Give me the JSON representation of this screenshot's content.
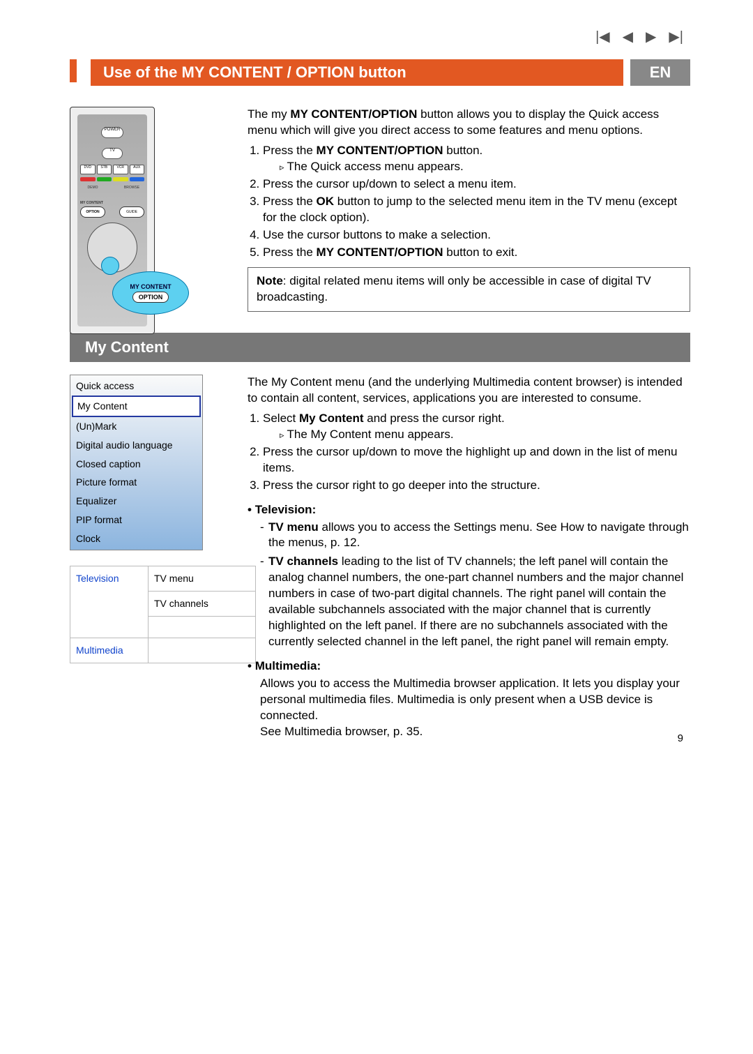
{
  "nav_icons": [
    "first-icon",
    "prev-icon",
    "next-icon",
    "last-icon"
  ],
  "header": {
    "title": "Use of the MY CONTENT / OPTION button",
    "lang": "EN"
  },
  "section1": {
    "intro_pre": "The my ",
    "intro_bold": "MY CONTENT/OPTION",
    "intro_post": " button allows you to display the Quick access menu which will give you direct access to some features and menu options.",
    "step1_pre": "Press the ",
    "step1_bold": "MY CONTENT/OPTION",
    "step1_post": " button.",
    "step1_result": "The Quick access menu appears.",
    "step2": "Press the cursor up/down to select a menu item.",
    "step3_pre": "Press the ",
    "step3_bold": "OK",
    "step3_post": " button to jump to the selected menu item in the TV menu (except for the clock option).",
    "step4": "Use the cursor buttons to make a selection.",
    "step5_pre": "Press the ",
    "step5_bold": "MY CONTENT/OPTION",
    "step5_post": " button to exit.",
    "note_bold": "Note",
    "note_text": ": digital related menu items will only be accessible in case of digital TV broadcasting."
  },
  "remote": {
    "power": "POWER",
    "tv": "TV",
    "src": [
      "DVD",
      "STB",
      "VCR",
      "AUX"
    ],
    "demo": "DEMO",
    "browse": "BROWSE",
    "mycontent": "MY CONTENT",
    "option": "OPTION",
    "guide": "GUIDE",
    "bubble_label": "MY CONTENT",
    "bubble_button": "OPTION",
    "colors": [
      "#d33",
      "#2a2",
      "#dd2",
      "#26d"
    ]
  },
  "section2": {
    "title": "My Content",
    "intro": "The My Content menu (and the underlying Multimedia content browser) is intended to contain all content, services, applications you are interested to consume.",
    "step1_pre": "Select ",
    "step1_bold": "My Content",
    "step1_post": " and press the cursor right.",
    "step1_result": "The My Content menu appears.",
    "step2": "Press the cursor up/down to move the highlight up and down in the list of menu items.",
    "step3": "Press the cursor right to go deeper into the structure.",
    "tv_heading": "Television",
    "tvmenu_bold": "TV menu",
    "tvmenu_text": " allows you to access the Settings menu. See How to navigate through the menus, p. 12.",
    "tvch_bold": "TV channels",
    "tvch_text": " leading to the list of TV channels; the left panel will contain the analog channel numbers, the one-part channel numbers and the major channel numbers in case of two-part digital channels. The right panel will contain the available subchannels associated with the major channel that is currently highlighted on the left panel. If there are no subchannels associated with the currently selected channel in the left panel, the right panel will remain empty.",
    "mm_heading": "Multimedia",
    "mm_text": "Allows you to access the Multimedia browser application. It lets you display your personal multimedia files. Multimedia is only present when a USB device is connected.\nSee Multimedia browser, p. 35."
  },
  "quick_access": {
    "title": "Quick access",
    "items": [
      "My Content",
      "(Un)Mark",
      "Digital audio language",
      "Closed caption",
      "Picture format",
      "Equalizer",
      "PIP format",
      "Clock"
    ],
    "selected_index": 0
  },
  "tv_table": {
    "left1": "Television",
    "right1a": "TV menu",
    "right1b": "TV channels",
    "left2": "Multimedia"
  },
  "page_number": "9"
}
